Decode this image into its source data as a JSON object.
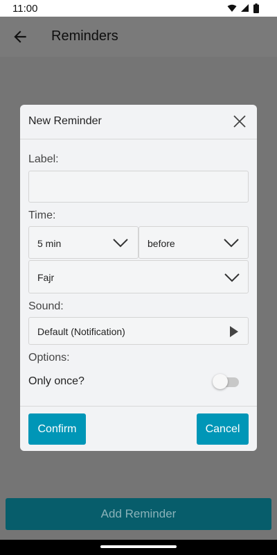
{
  "status_bar": {
    "time": "11:00"
  },
  "app_bar": {
    "title": "Reminders"
  },
  "dialog": {
    "title": "New Reminder",
    "label_heading": "Label:",
    "label_value": "",
    "time_heading": "Time:",
    "offset_value": "5 min",
    "relation_value": "before",
    "prayer_value": "Fajr",
    "sound_heading": "Sound:",
    "sound_value": "Default (Notification)",
    "options_heading": "Options:",
    "only_once_label": "Only once?",
    "only_once_enabled": false,
    "confirm_label": "Confirm",
    "cancel_label": "Cancel"
  },
  "add_button_label": "Add Reminder",
  "colors": {
    "accent": "#0096b7",
    "add_button_dimmed": "#075d6b",
    "scrim": "#777777"
  },
  "icons": [
    "wifi-icon",
    "signal-icon",
    "battery-icon",
    "back-arrow-icon",
    "close-icon",
    "chevron-down-icon",
    "play-icon"
  ]
}
